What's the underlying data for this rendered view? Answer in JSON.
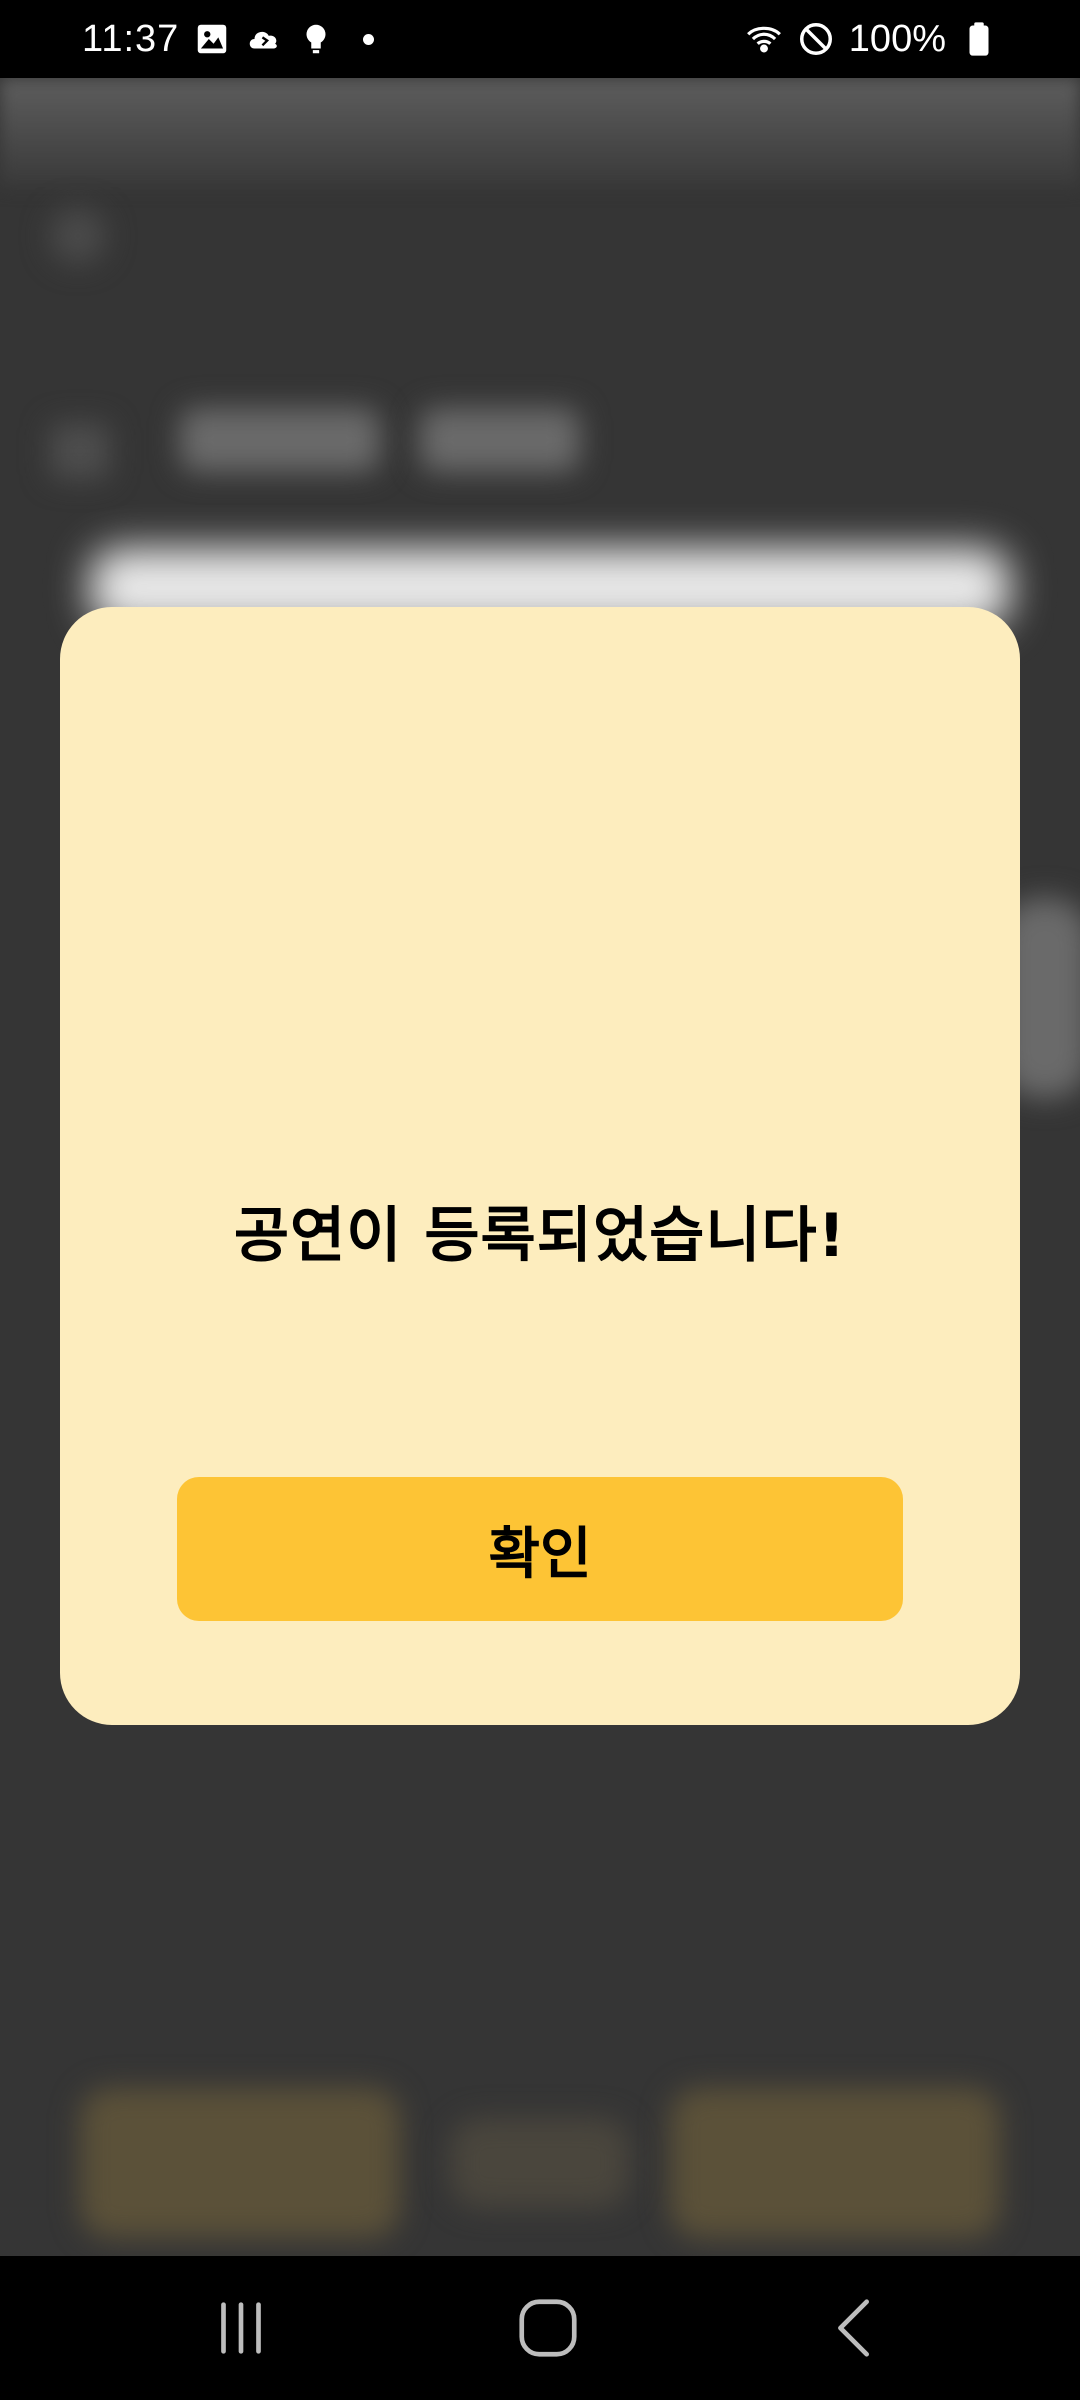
{
  "status_bar": {
    "time": "11:37",
    "battery": "100%",
    "left_icons": [
      "gallery-icon",
      "cloud-icon",
      "bulb-icon",
      "notification-dot-icon"
    ],
    "right_icons": [
      "wifi-icon",
      "do-not-disturb-icon",
      "battery-icon"
    ]
  },
  "dialog": {
    "message": "공연이 등록되었습니다!",
    "confirm_label": "확인"
  },
  "nav_bar": {
    "items": [
      "recent-apps-icon",
      "home-icon",
      "back-icon"
    ]
  },
  "colors": {
    "dialog_background": "#fdedbe",
    "confirm_button": "#fdc435",
    "scrim_background": "#353535"
  }
}
